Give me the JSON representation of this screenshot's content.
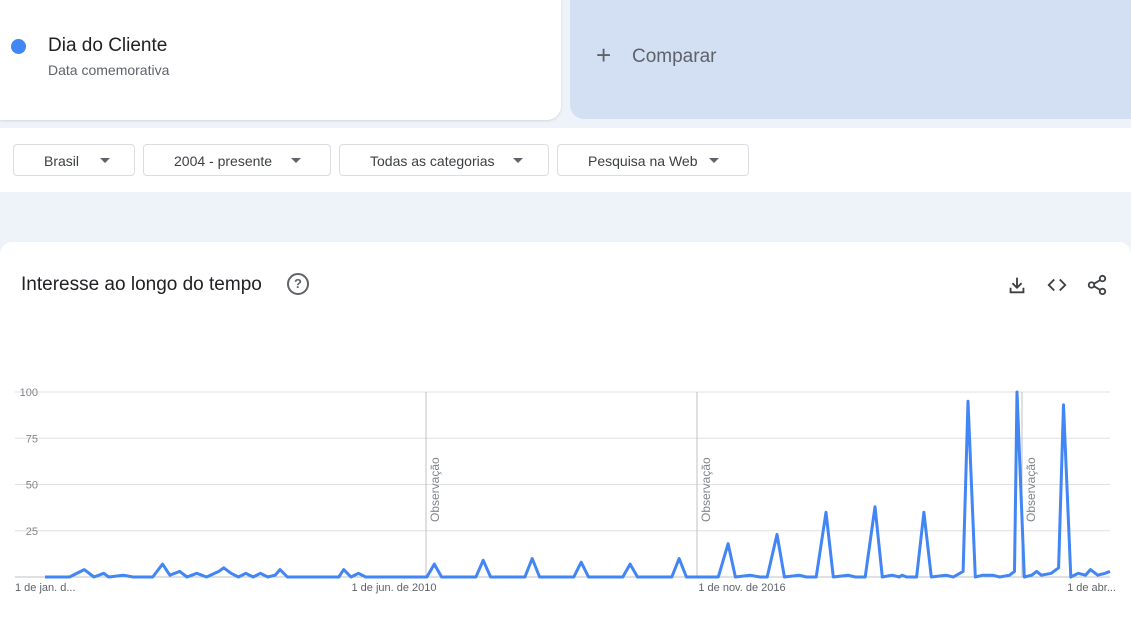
{
  "term": {
    "title": "Dia do Cliente",
    "subtitle": "Data comemorativa",
    "color": "#4285f4"
  },
  "compare": {
    "plus": "+",
    "label": "Comparar"
  },
  "filters": [
    {
      "label": "Brasil"
    },
    {
      "label": "2004 - presente"
    },
    {
      "label": "Todas as categorias"
    },
    {
      "label": "Pesquisa na Web"
    }
  ],
  "chart_panel": {
    "title": "Interesse ao longo do tempo",
    "help_icon": "help-circle-icon",
    "tools": [
      "download-icon",
      "embed-code-icon",
      "share-icon"
    ]
  },
  "chart_data": {
    "type": "line",
    "ylim": [
      0,
      100
    ],
    "y_ticks": [
      "100",
      "75",
      "50",
      "25"
    ],
    "x_tick_labels": [
      "1 de jan. d...",
      "1 de jun. de 2010",
      "1 de nov. de 2016",
      "1 de abr..."
    ],
    "annotation_label": "Observação",
    "grid": true,
    "series": [
      {
        "color": "#4285f4",
        "points": [
          [
            2004.0,
            0
          ],
          [
            2004.5,
            0
          ],
          [
            2004.8,
            4
          ],
          [
            2005.0,
            0
          ],
          [
            2005.2,
            2
          ],
          [
            2005.3,
            0
          ],
          [
            2005.6,
            1
          ],
          [
            2005.8,
            0
          ],
          [
            2006.2,
            0
          ],
          [
            2006.4,
            7
          ],
          [
            2006.55,
            1
          ],
          [
            2006.75,
            3
          ],
          [
            2006.9,
            0
          ],
          [
            2007.1,
            2
          ],
          [
            2007.3,
            0
          ],
          [
            2007.55,
            3
          ],
          [
            2007.65,
            5
          ],
          [
            2007.8,
            2
          ],
          [
            2007.95,
            0
          ],
          [
            2008.1,
            2
          ],
          [
            2008.25,
            0
          ],
          [
            2008.4,
            2
          ],
          [
            2008.55,
            0
          ],
          [
            2008.7,
            1
          ],
          [
            2008.8,
            4
          ],
          [
            2008.95,
            0
          ],
          [
            2010.0,
            0
          ],
          [
            2010.1,
            4
          ],
          [
            2010.25,
            0
          ],
          [
            2010.4,
            2
          ],
          [
            2010.55,
            0
          ],
          [
            2011.8,
            0
          ],
          [
            2011.95,
            7
          ],
          [
            2012.1,
            0
          ],
          [
            2012.8,
            0
          ],
          [
            2012.95,
            9
          ],
          [
            2013.1,
            0
          ],
          [
            2013.8,
            0
          ],
          [
            2013.95,
            10
          ],
          [
            2014.1,
            0
          ],
          [
            2014.8,
            0
          ],
          [
            2014.95,
            8
          ],
          [
            2015.1,
            0
          ],
          [
            2015.8,
            0
          ],
          [
            2015.95,
            7
          ],
          [
            2016.1,
            0
          ],
          [
            2016.8,
            0
          ],
          [
            2016.95,
            10
          ],
          [
            2017.1,
            0
          ],
          [
            2017.75,
            0
          ],
          [
            2017.95,
            18
          ],
          [
            2018.1,
            0
          ],
          [
            2018.4,
            1
          ],
          [
            2018.6,
            0
          ],
          [
            2018.75,
            0
          ],
          [
            2018.95,
            23
          ],
          [
            2019.1,
            0
          ],
          [
            2019.4,
            1
          ],
          [
            2019.55,
            0
          ],
          [
            2019.75,
            0
          ],
          [
            2019.95,
            35
          ],
          [
            2020.1,
            0
          ],
          [
            2020.4,
            1
          ],
          [
            2020.55,
            0
          ],
          [
            2020.75,
            0
          ],
          [
            2020.95,
            38
          ],
          [
            2021.1,
            0
          ],
          [
            2021.3,
            1
          ],
          [
            2021.45,
            0
          ],
          [
            2021.5,
            1
          ],
          [
            2021.6,
            0
          ],
          [
            2021.8,
            0
          ],
          [
            2021.95,
            35
          ],
          [
            2022.1,
            0
          ],
          [
            2022.4,
            1
          ],
          [
            2022.55,
            0
          ],
          [
            2022.75,
            3
          ],
          [
            2022.85,
            95
          ],
          [
            2023.0,
            0
          ],
          [
            2023.15,
            1
          ],
          [
            2023.35,
            1
          ],
          [
            2023.5,
            0
          ],
          [
            2023.7,
            1
          ],
          [
            2023.8,
            3
          ],
          [
            2023.85,
            100
          ],
          [
            2024.0,
            0
          ],
          [
            2024.15,
            1
          ],
          [
            2024.25,
            3
          ],
          [
            2024.35,
            1
          ],
          [
            2024.55,
            2
          ],
          [
            2024.7,
            5
          ],
          [
            2024.8,
            93
          ],
          [
            2024.95,
            0
          ],
          [
            2025.1,
            2
          ],
          [
            2025.25,
            1
          ],
          [
            2025.35,
            4
          ],
          [
            2025.5,
            1
          ],
          [
            2025.65,
            2
          ],
          [
            2025.75,
            3
          ]
        ]
      }
    ]
  }
}
